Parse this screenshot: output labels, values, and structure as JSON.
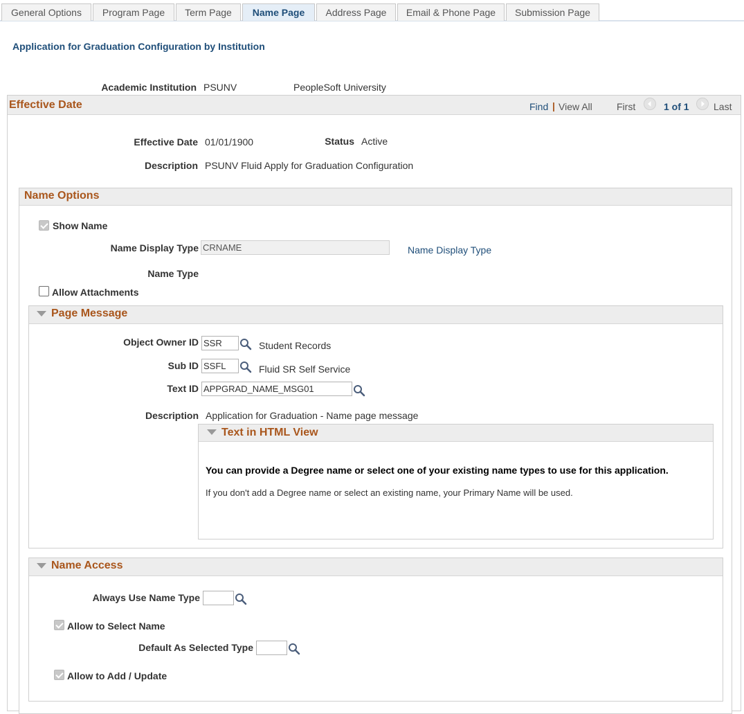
{
  "tabs": [
    {
      "label": "General Options",
      "active": false
    },
    {
      "label": "Program Page",
      "active": false
    },
    {
      "label": "Term Page",
      "active": false
    },
    {
      "label": "Name Page",
      "active": true
    },
    {
      "label": "Address Page",
      "active": false
    },
    {
      "label": "Email & Phone Page",
      "active": false
    },
    {
      "label": "Submission Page",
      "active": false
    }
  ],
  "page_title": "Application for Graduation Configuration by Institution",
  "institution": {
    "label": "Academic Institution",
    "code": "PSUNV",
    "name": "PeopleSoft University"
  },
  "effective_date_panel": {
    "title": "Effective Date",
    "nav": {
      "find": "Find",
      "separator": "|",
      "view_all": "View All",
      "first": "First",
      "count": "1 of 1",
      "last": "Last"
    },
    "effective_date_label": "Effective Date",
    "effective_date": "01/01/1900",
    "status_label": "Status",
    "status": "Active",
    "description_label": "Description",
    "description": "PSUNV Fluid Apply for Graduation Configuration"
  },
  "name_options": {
    "title": "Name Options",
    "show_name_label": "Show Name",
    "show_name_checked": true,
    "name_display_type_label": "Name Display Type",
    "name_display_type_value": "CRNAME",
    "name_display_type_link": "Name Display Type",
    "name_type_label": "Name Type",
    "allow_attachments_label": "Allow Attachments",
    "allow_attachments_checked": false
  },
  "page_message": {
    "title": "Page Message",
    "object_owner_label": "Object Owner ID",
    "object_owner_value": "SSR",
    "object_owner_desc": "Student Records",
    "sub_id_label": "Sub ID",
    "sub_id_value": "SSFL",
    "sub_id_desc": "Fluid SR Self Service",
    "text_id_label": "Text ID",
    "text_id_value": "APPGRAD_NAME_MSG01",
    "description_label": "Description",
    "description": "Application for Graduation - Name page message",
    "html_view": {
      "title": "Text in HTML View",
      "bold_line": "You can provide a Degree name or select one of your existing name types to use for this application.",
      "normal_line": "If you don't add a Degree name or select an existing name, your Primary Name will be used."
    }
  },
  "name_access": {
    "title": "Name Access",
    "always_use_label": "Always Use Name Type",
    "always_use_value": "",
    "allow_select_label": "Allow to Select Name",
    "allow_select_checked": true,
    "default_selected_label": "Default As Selected Type",
    "default_selected_value": "",
    "allow_add_label": "Allow to Add / Update",
    "allow_add_checked": true
  },
  "colors": {
    "accent_orange": "#a9561c",
    "link_blue": "#1f4e79",
    "header_gray": "#ededed"
  }
}
